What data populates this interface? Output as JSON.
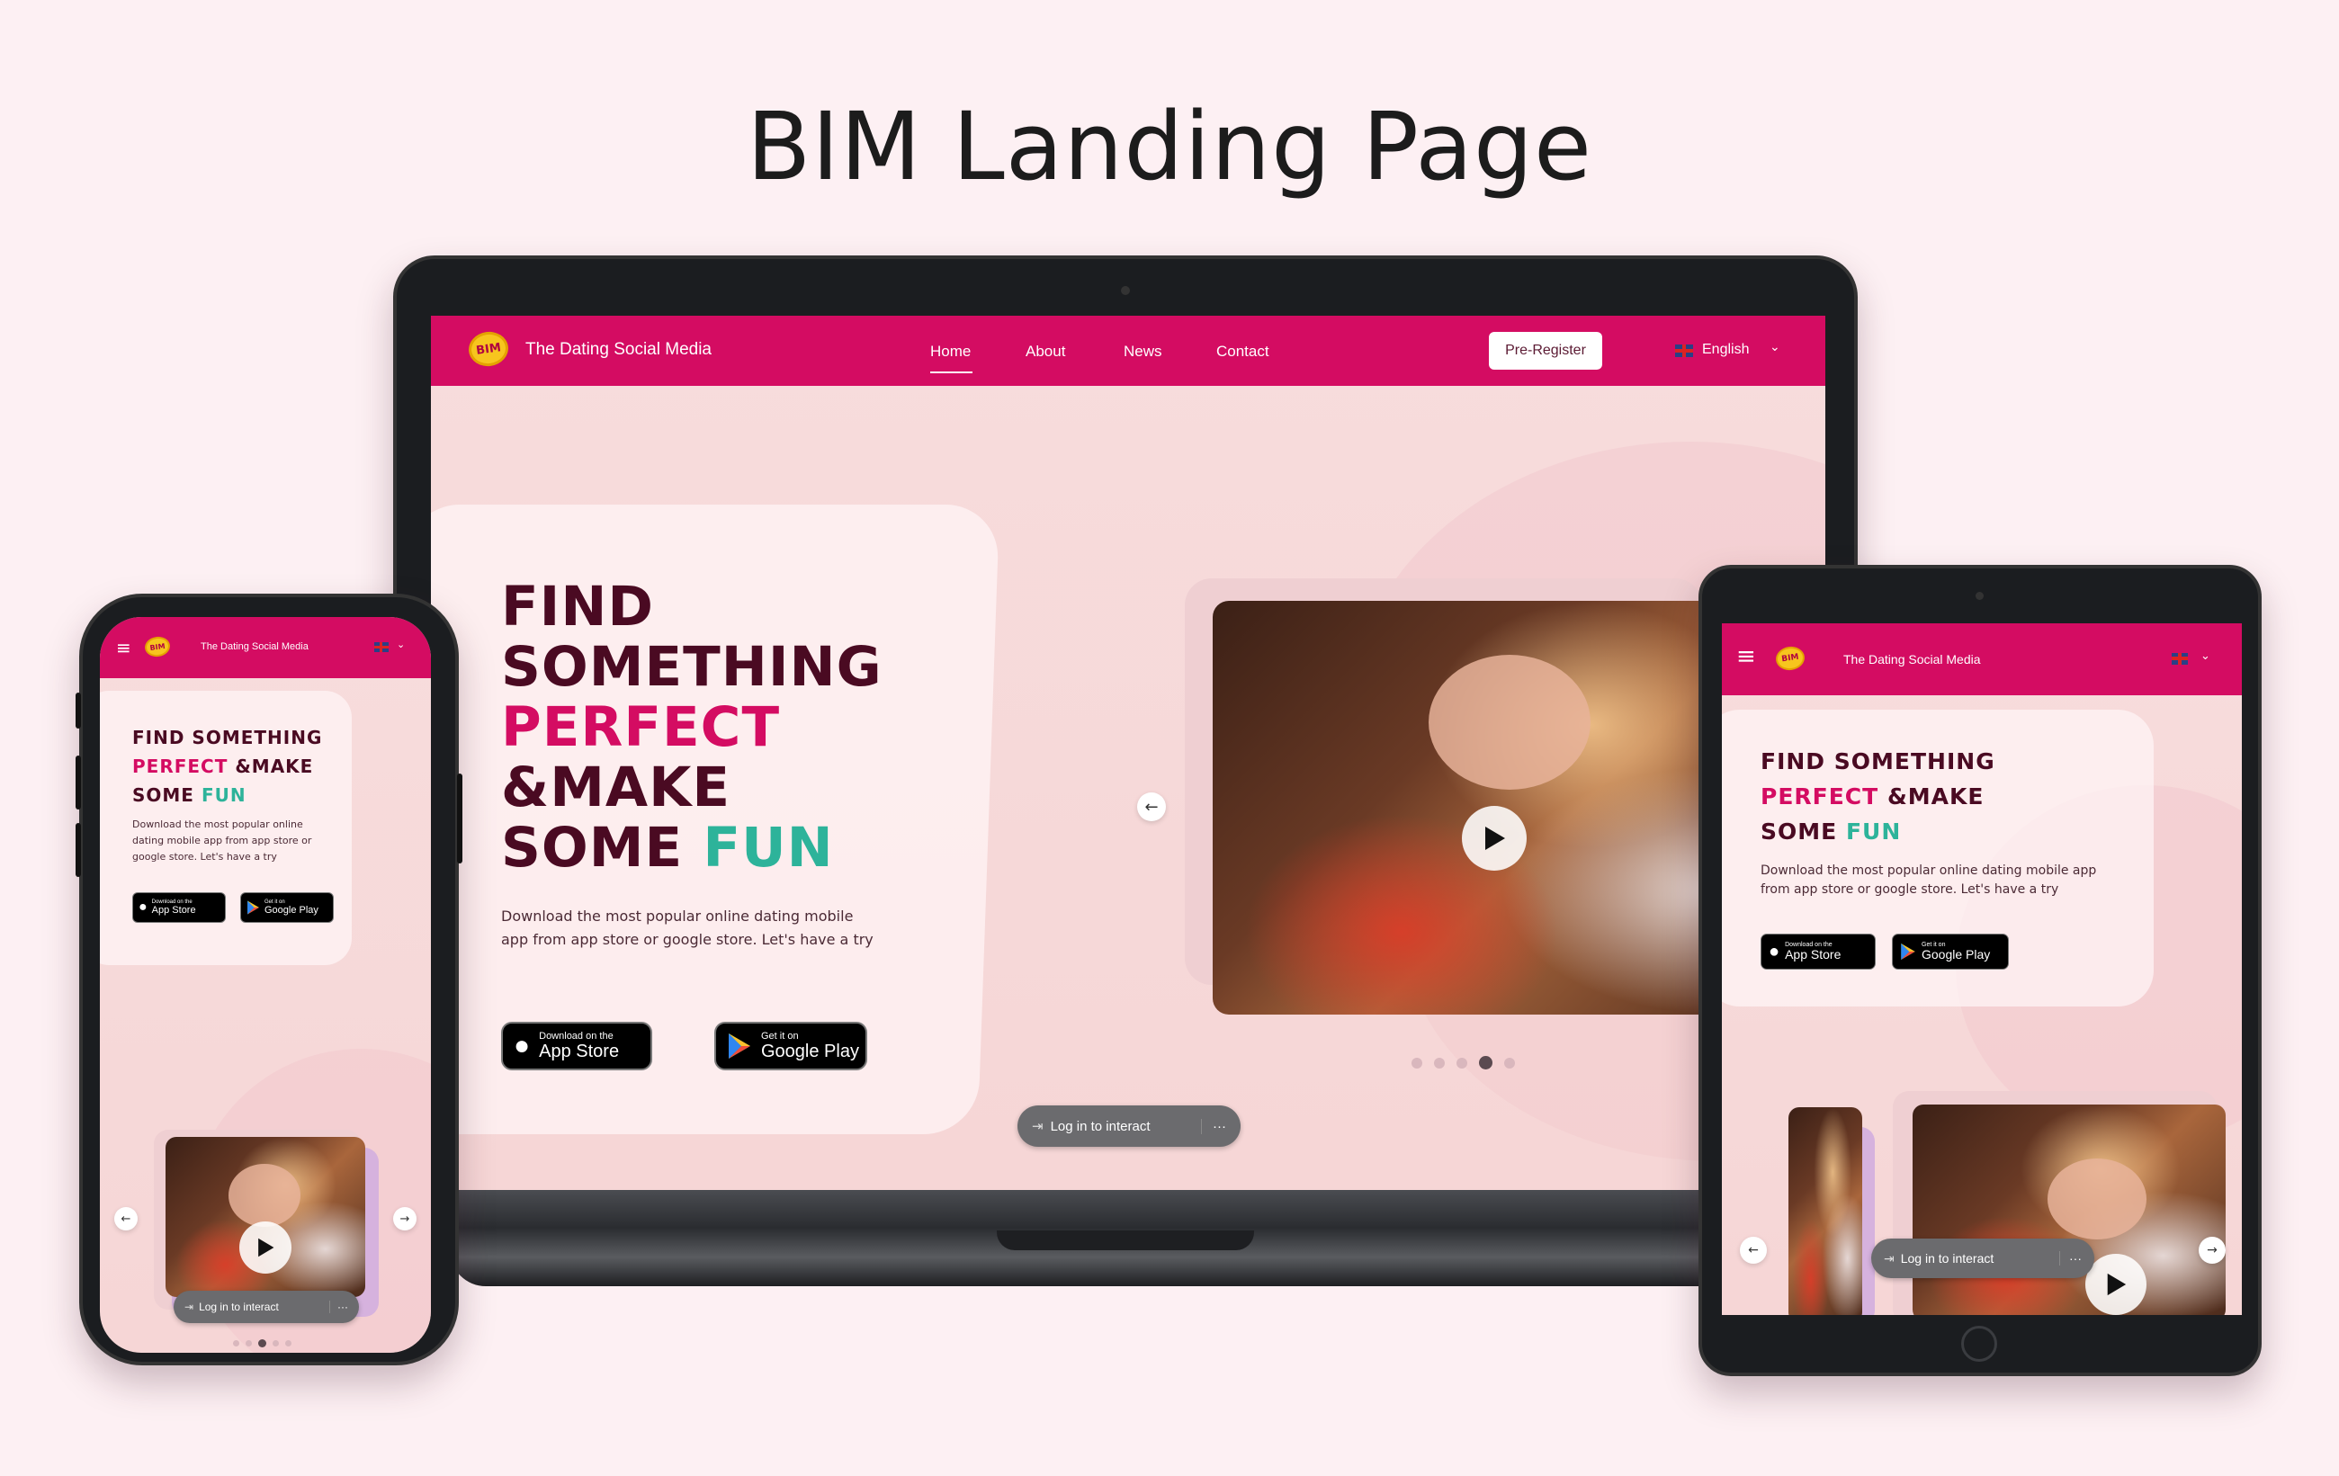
{
  "page_title": "BIM Landing Page",
  "site": {
    "logo_text": "BIM",
    "brand": "The Dating Social Media",
    "nav": [
      "Home",
      "About",
      "News",
      "Contact"
    ],
    "active_nav": "Home",
    "pre_register": "Pre-Register",
    "language": "English"
  },
  "hero": {
    "line1": "FIND",
    "line2": "SOMETHING",
    "line3_pink": "PERFECT",
    "line4": "&MAKE",
    "line5": "SOME",
    "line5_teal": "FUN",
    "description": "Download the most popular online dating mobile app from app store or google store. Let's have a try"
  },
  "stores": {
    "apple_small": "Download on the",
    "apple_big": "App Store",
    "google_small": "Get it on",
    "google_big": "Google Play"
  },
  "login_pill": {
    "label": "Log in to interact",
    "more": "···"
  },
  "carousel": {
    "dots": 5,
    "active_dot": 4
  },
  "colors": {
    "brand_pink": "#d40c62",
    "teal": "#2db39a",
    "dark": "#4a0a22",
    "background": "#fdf0f3"
  }
}
